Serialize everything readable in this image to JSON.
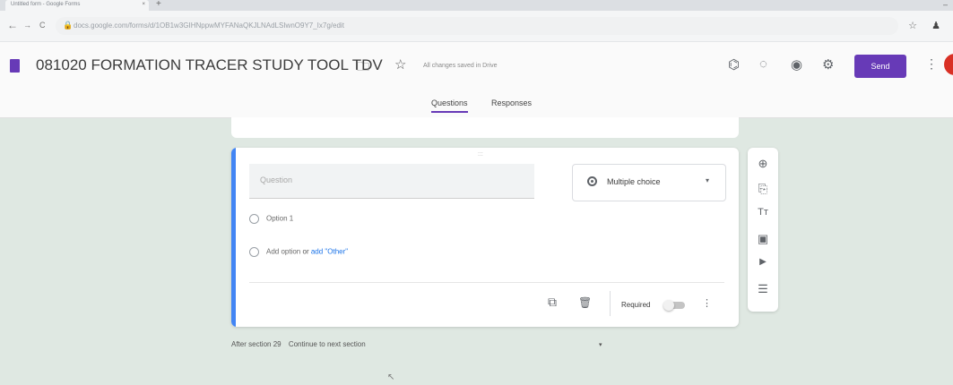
{
  "browser": {
    "tab_title": "Untitled form - Google Forms",
    "tab_close": "×",
    "new_tab": "+",
    "url": "docs.google.com/forms/d/1OB1w3GIHNppwMYFANaQKJLNAdLSIwnO9Y7_Ix7g/edit",
    "nav_back": "←",
    "nav_forward": "→",
    "nav_reload": "C",
    "lock": "🔒",
    "bookmark": "☆",
    "extension": "♟",
    "window_min": "–"
  },
  "form": {
    "title": "081020 FORMATION TRACER STUDY TOOL TDV",
    "save_status": "All changes saved in Drive",
    "send_label": "Send",
    "tabs": [
      "Questions",
      "Responses"
    ]
  },
  "toolbar_icons": {
    "addons": "⌬",
    "palette": "◌",
    "preview": "◉",
    "settings": "⚙",
    "more": "⋮",
    "folder": "🗀",
    "star": "☆"
  },
  "question": {
    "drag_handle": ":::",
    "placeholder": "Question",
    "type": "Multiple choice",
    "type_arrow": "▾",
    "option1": "Option 1",
    "add_option": "Add option",
    "or": "or",
    "add_other": "add \"Other\"",
    "required_label": "Required",
    "duplicate_icon": "⧉",
    "delete_icon": "🗑",
    "more_icon": "⋮"
  },
  "sidebar_icons": {
    "add_question": "⊕",
    "import": "⎘",
    "title_text": "Tт",
    "image": "▣",
    "video": "▶",
    "section": "☰"
  },
  "footer": {
    "after_section": "After section 29",
    "action": "Continue to next section",
    "arrow": "▾"
  },
  "colors": {
    "accent": "#673ab7",
    "active_bar": "#4285f4",
    "background": "#dfe8e2"
  }
}
